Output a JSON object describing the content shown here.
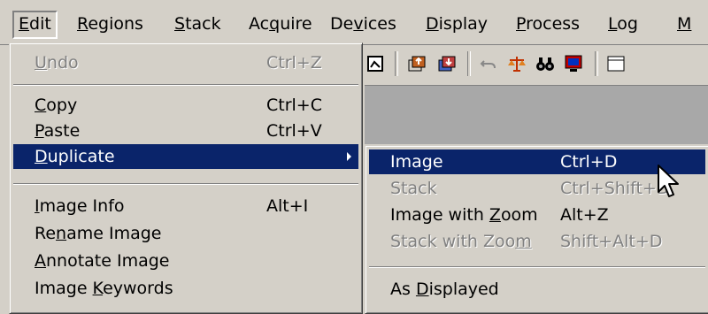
{
  "menubar": {
    "items": [
      {
        "pre": "",
        "acc": "E",
        "post": "dit"
      },
      {
        "pre": "",
        "acc": "R",
        "post": "egions"
      },
      {
        "pre": "",
        "acc": "S",
        "post": "tack"
      },
      {
        "pre": "Ac",
        "acc": "q",
        "post": "uire"
      },
      {
        "pre": "De",
        "acc": "v",
        "post": "ices"
      },
      {
        "pre": "",
        "acc": "D",
        "post": "isplay"
      },
      {
        "pre": "",
        "acc": "P",
        "post": "rocess"
      },
      {
        "pre": "",
        "acc": "L",
        "post": "og"
      },
      {
        "pre": "",
        "acc": "M",
        "post": ""
      }
    ]
  },
  "toolbar": {
    "icons": [
      "image-icon",
      "stack-up-icon",
      "stack-down-icon",
      "undo-icon",
      "balance-icon",
      "binoculars-icon",
      "color-icon",
      "fs-icon"
    ]
  },
  "edit_menu": {
    "items": [
      {
        "pre": "",
        "acc": "U",
        "post": "ndo",
        "shortcut": "Ctrl+Z"
      },
      {
        "pre": "",
        "acc": "C",
        "post": "opy",
        "shortcut": "Ctrl+C"
      },
      {
        "pre": "",
        "acc": "P",
        "post": "aste",
        "shortcut": "Ctrl+V"
      },
      {
        "pre": "",
        "acc": "D",
        "post": "uplicate",
        "shortcut": ""
      },
      {
        "pre": "",
        "acc": "I",
        "post": "mage Info",
        "shortcut": "Alt+I"
      },
      {
        "pre": "Re",
        "acc": "n",
        "post": "ame Image",
        "shortcut": ""
      },
      {
        "pre": "",
        "acc": "A",
        "post": "nnotate Image",
        "shortcut": ""
      },
      {
        "pre": "Image ",
        "acc": "K",
        "post": "eywords",
        "shortcut": ""
      }
    ]
  },
  "submenu": {
    "items": [
      {
        "pre": "Image",
        "acc": "",
        "post": "",
        "shortcut": "Ctrl+D"
      },
      {
        "pre": "Stack",
        "acc": "",
        "post": "",
        "shortcut": "Ctrl+Shift+D"
      },
      {
        "pre": "Image with ",
        "acc": "Z",
        "post": "oom",
        "shortcut": "Alt+Z"
      },
      {
        "pre": "Stack with Zoo",
        "acc": "m",
        "post": "",
        "shortcut": "Shift+Alt+D"
      },
      {
        "pre": "As ",
        "acc": "D",
        "post": "isplayed",
        "shortcut": ""
      }
    ]
  },
  "colors": {
    "face": "#d4d0c8",
    "highlight": "#0a246a",
    "disabled": "#808080"
  }
}
